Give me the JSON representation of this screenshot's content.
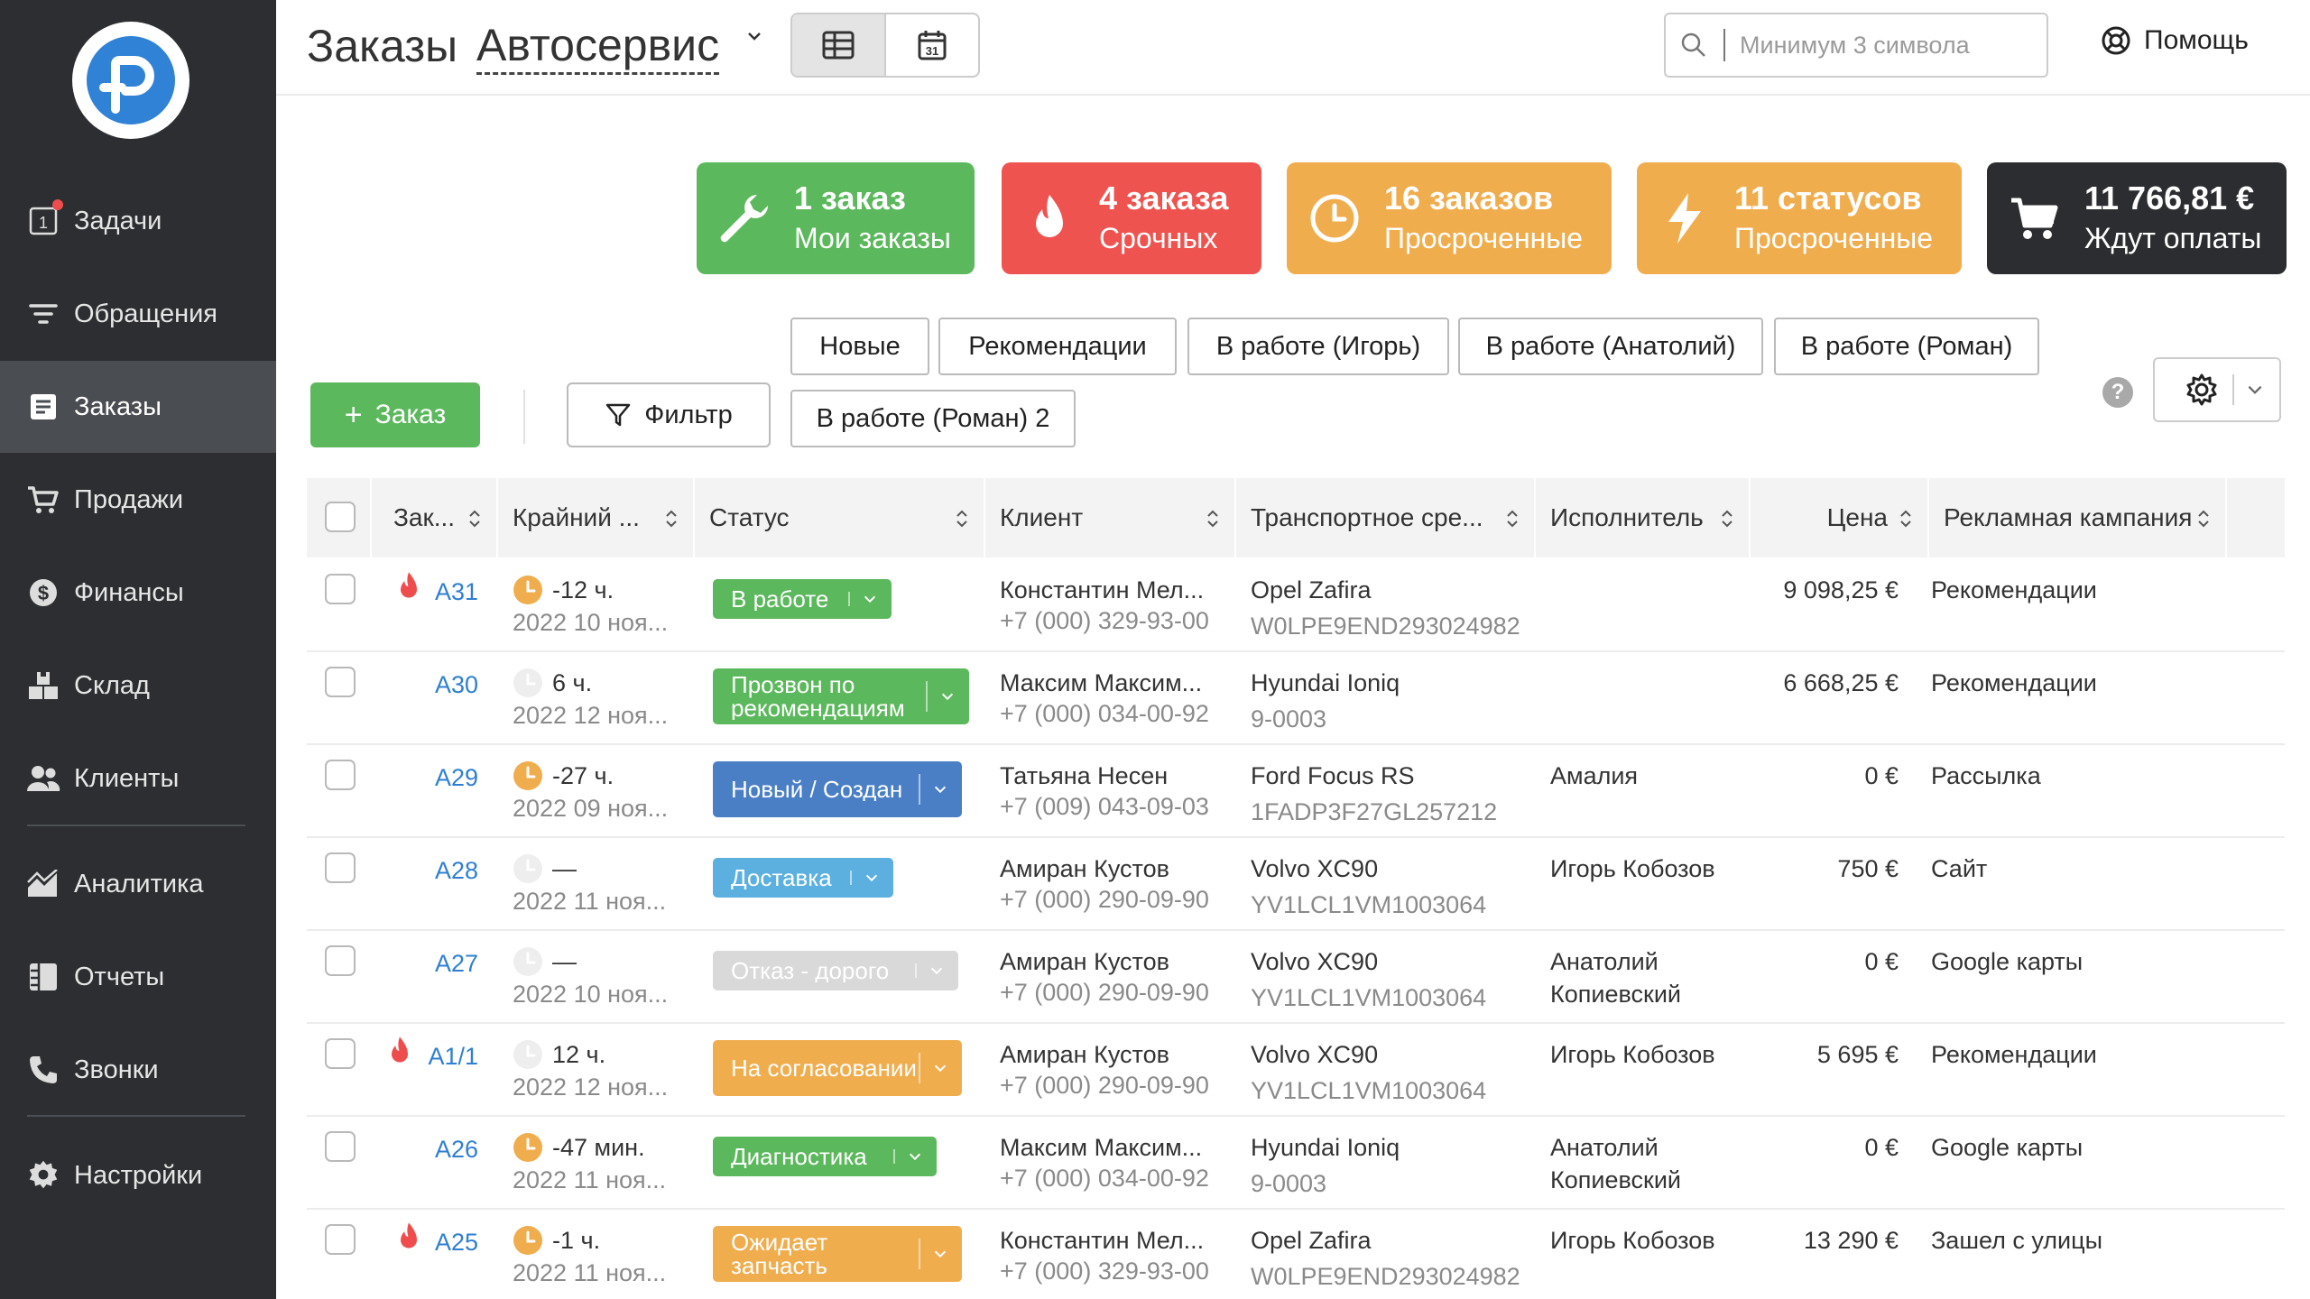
{
  "sidebar": {
    "items": [
      {
        "label": "Задачи",
        "icon": "tasks-icon",
        "badge": "1"
      },
      {
        "label": "Обращения",
        "icon": "filter-icon"
      },
      {
        "label": "Заказы",
        "icon": "orders-icon",
        "active": true
      },
      {
        "label": "Продажи",
        "icon": "cart-icon"
      },
      {
        "label": "Финансы",
        "icon": "dollar-icon"
      },
      {
        "label": "Склад",
        "icon": "warehouse-icon"
      },
      {
        "label": "Клиенты",
        "icon": "clients-icon"
      },
      {
        "label": "Аналитика",
        "icon": "analytics-icon"
      },
      {
        "label": "Отчеты",
        "icon": "reports-icon"
      },
      {
        "label": "Звонки",
        "icon": "phone-icon"
      },
      {
        "label": "Настройки",
        "icon": "settings-icon"
      }
    ]
  },
  "header": {
    "title": "Заказы",
    "workshop": "Автосервис",
    "calendar_day": "31",
    "search_placeholder": "Минимум 3 символа",
    "help_label": "Помощь"
  },
  "cards": [
    {
      "line1": "1 заказ",
      "line2": "Мои заказы",
      "color": "#5cb85c",
      "icon": "wrench-icon"
    },
    {
      "line1": "4 заказа",
      "line2": "Срочных",
      "color": "#ef5350",
      "icon": "fire-icon"
    },
    {
      "line1": "16 заказов",
      "line2": "Просроченные",
      "color": "#f0ad4e",
      "icon": "clock-icon"
    },
    {
      "line1": "11 статусов",
      "line2": "Просроченные",
      "color": "#f0ad4e",
      "icon": "lightning-icon"
    },
    {
      "line1": "11 766,81 €",
      "line2": "Ждут оплаты",
      "color": "#2b2d30",
      "icon": "cart-icon"
    }
  ],
  "toolbar": {
    "add_label": "Заказ",
    "filter_label": "Фильтр",
    "chips": [
      "Новые",
      "Рекомендации",
      "В работе (Игорь)",
      "В работе (Анатолий)",
      "В работе (Роман)",
      "В работе (Роман) 2"
    ]
  },
  "table": {
    "columns": [
      "Зак...",
      "Крайний ...",
      "Статус",
      "Клиент",
      "Транспортное сре...",
      "Исполнитель",
      "Цена",
      "Рекламная кампания"
    ],
    "rows": [
      {
        "urgent": true,
        "order": "A31",
        "clock": "orange",
        "deadline": "-12 ч.",
        "date": "2022 10 ноя...",
        "status": "В работе",
        "status_color": "#5cb85c",
        "client": "Константин Мел...",
        "phone": "+7 (000) 329-93-00",
        "vehicle": "Opel Zafira",
        "vin": "W0LPE9END293024982",
        "executor": "",
        "price": "9 098,25 €",
        "campaign": "Рекомендации"
      },
      {
        "urgent": false,
        "order": "A30",
        "clock": "grey",
        "deadline": "6 ч.",
        "date": "2022 12 ноя...",
        "status": "Прозвон по рекомендациям",
        "status_color": "#5cb85c",
        "client": "Максим Максим...",
        "phone": "+7 (000) 034-00-92",
        "vehicle": "Hyundai Ioniq",
        "vin": "9-0003",
        "executor": "",
        "price": "6 668,25 €",
        "campaign": "Рекомендации"
      },
      {
        "urgent": false,
        "order": "A29",
        "clock": "orange",
        "deadline": "-27 ч.",
        "date": "2022 09 ноя...",
        "status": "Новый / Создан",
        "status_color": "#4a7fc6",
        "client": "Татьяна Несен",
        "phone": "+7 (009) 043-09-03",
        "vehicle": "Ford Focus RS",
        "vin": "1FADP3F27GL257212",
        "executor": "Амалия",
        "price": "0 €",
        "campaign": "Рассылка"
      },
      {
        "urgent": false,
        "order": "A28",
        "clock": "grey",
        "deadline": "—",
        "date": "2022 11 ноя...",
        "status": "Доставка",
        "status_color": "#5bb0e0",
        "client": "Амиран Кустов",
        "phone": "+7 (000) 290-09-90",
        "vehicle": "Volvo XC90",
        "vin": "YV1LCL1VM1003064",
        "executor": "Игорь Кобозов",
        "price": "750 €",
        "campaign": "Сайт"
      },
      {
        "urgent": false,
        "order": "A27",
        "clock": "grey",
        "deadline": "—",
        "date": "2022 10 ноя...",
        "status": "Отказ - дорого",
        "status_color": "#d9d9d9",
        "client": "Амиран Кустов",
        "phone": "+7 (000) 290-09-90",
        "vehicle": "Volvo XC90",
        "vin": "YV1LCL1VM1003064",
        "executor": "Анатолий Копиевский",
        "price": "0 €",
        "campaign": "Google карты"
      },
      {
        "urgent": true,
        "order": "A1/1",
        "clock": "grey",
        "deadline": "12 ч.",
        "date": "2022 12 ноя...",
        "status": "На согласовании",
        "status_color": "#f0ad4e",
        "client": "Амиран Кустов",
        "phone": "+7 (000) 290-09-90",
        "vehicle": "Volvo XC90",
        "vin": "YV1LCL1VM1003064",
        "executor": "Игорь Кобозов",
        "price": "5 695 €",
        "campaign": "Рекомендации"
      },
      {
        "urgent": false,
        "order": "A26",
        "clock": "orange",
        "deadline": "-47 мин.",
        "date": "2022 11 ноя...",
        "status": "Диагностика",
        "status_color": "#5cb85c",
        "client": "Максим Максим...",
        "phone": "+7 (000) 034-00-92",
        "vehicle": "Hyundai Ioniq",
        "vin": "9-0003",
        "executor": "Анатолий Копиевский",
        "price": "0 €",
        "campaign": "Google карты"
      },
      {
        "urgent": true,
        "order": "A25",
        "clock": "orange",
        "deadline": "-1 ч.",
        "date": "2022 11 ноя...",
        "status": "Ожидает запчасть",
        "status_color": "#f0ad4e",
        "client": "Константин Мел...",
        "phone": "+7 (000) 329-93-00",
        "vehicle": "Opel Zafira",
        "vin": "W0LPE9END293024982",
        "executor": "Игорь Кобозов",
        "price": "13 290 €",
        "campaign": "Зашел с улицы"
      }
    ]
  }
}
